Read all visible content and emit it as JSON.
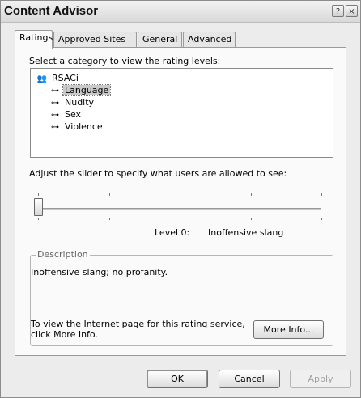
{
  "window": {
    "title": "Content Advisor",
    "help_glyph": "?",
    "close_glyph": "×"
  },
  "tabs": [
    {
      "label": "Ratings",
      "active": true
    },
    {
      "label": "Approved Sites",
      "active": false
    },
    {
      "label": "General",
      "active": false
    },
    {
      "label": "Advanced",
      "active": false
    }
  ],
  "ratings": {
    "select_prompt": "Select a category to view the rating levels:",
    "tree": {
      "root": {
        "label": "RSACi",
        "icon": "rating-service-icon",
        "glyph": "👥"
      },
      "items": [
        {
          "label": "Language",
          "icon": "key-icon",
          "glyph": "⊶",
          "selected": true
        },
        {
          "label": "Nudity",
          "icon": "key-icon",
          "glyph": "⊶",
          "selected": false
        },
        {
          "label": "Sex",
          "icon": "key-icon",
          "glyph": "⊶",
          "selected": false
        },
        {
          "label": "Violence",
          "icon": "key-icon",
          "glyph": "⊶",
          "selected": false
        }
      ]
    },
    "slider_prompt": "Adjust the slider to specify what users are allowed to see:",
    "slider": {
      "level_fraction": 0.0,
      "ticks": 5
    },
    "level_label": "Level 0:",
    "level_value": "Inoffensive slang",
    "description": {
      "legend": "Description",
      "text": "Inoffensive slang; no profanity.",
      "more_info_text": "To view the Internet page for this rating service, click More Info.",
      "more_info_button": "More Info..."
    }
  },
  "footer": {
    "ok": "OK",
    "cancel": "Cancel",
    "apply": "Apply",
    "apply_enabled": false
  }
}
